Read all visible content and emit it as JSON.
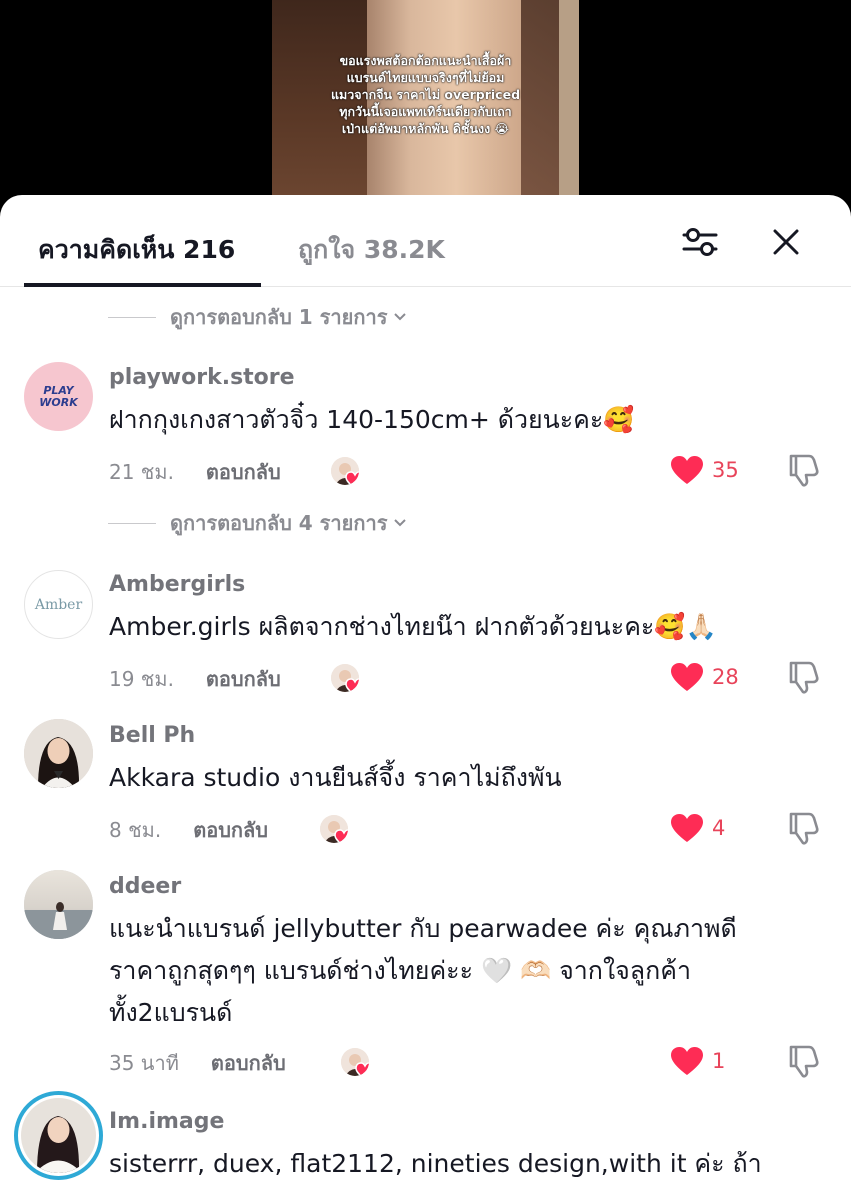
{
  "video": {
    "caption_lines": [
      "ขอแรงพสต้อกต้อกแนะนำเสื้อผ้า",
      "แบรนด์ไทยแบบจริงๆที่ไม่ย้อม",
      "แมวจากจีน ราคาไม่ overpriced",
      "ทุกวันนี้เจอแพทเทิร์นเดียวกับเถา",
      "เป่าแต่อัพมาหลักพัน ดิชั้นงง 😭"
    ]
  },
  "tabs": {
    "comments_label": "ความคิดเห็น 216",
    "likes_label": "ถูกใจ 38.2K"
  },
  "icons": {
    "filter": "sliders-icon",
    "close": "close-icon",
    "like": "heart-icon",
    "dislike": "thumbs-down-icon"
  },
  "colors": {
    "like": "#FE2C55",
    "text": "#161823",
    "muted": "#8A8B91"
  },
  "view_replies": [
    {
      "label": "ดูการตอบกลับ 1 รายการ"
    },
    {
      "label": "ดูการตอบกลับ 4 รายการ"
    }
  ],
  "comments": [
    {
      "username": "playwork.store",
      "avatar_text": "PLAY WORK",
      "text_lines": [
        "ฝากกุงเกงสาวตัวจิ๋ว 140-150cm+ ด้วยนะคะ🥰"
      ],
      "time": "21 ชม.",
      "reply_label": "ตอบกลับ",
      "likes": "35"
    },
    {
      "username": "Ambergirls",
      "avatar_text": "Amber",
      "text_lines": [
        "Amber.girls ผลิตจากช่างไทยน๊า ฝากตัวด้วยนะคะ🥰🙏🏻"
      ],
      "time": "19 ชม.",
      "reply_label": "ตอบกลับ",
      "likes": "28"
    },
    {
      "username": "Bell Ph",
      "text_lines": [
        "Akkara studio งานยีนส์จึ้ง ราคาไม่ถึงพัน"
      ],
      "time": "8 ชม.",
      "reply_label": "ตอบกลับ",
      "likes": "4"
    },
    {
      "username": "ddeer",
      "text_lines": [
        "แนะนำแบรนด์ jellybutter กับ pearwadee ค่ะ คุณภาพดี",
        "ราคาถูกสุดๆๆ แบรนด์ช่างไทยค่ะะ 🤍 🫶🏻 จากใจลูกค้า",
        "ทั้ง2แบรนด์"
      ],
      "time": "35 นาที",
      "reply_label": "ตอบกลับ",
      "likes": "1"
    },
    {
      "username": "Im.image",
      "text_lines": [
        "sisterrr, duex, flat2112, nineties design,with it ค่ะ ถ้า"
      ]
    }
  ]
}
